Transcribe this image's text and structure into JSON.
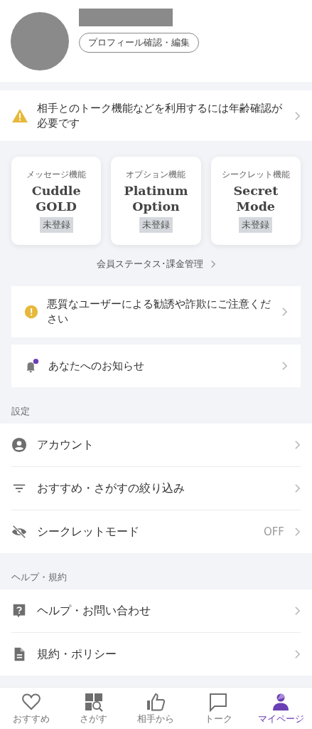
{
  "profile": {
    "edit_button": "プロフィール確認・編集"
  },
  "age_notice": {
    "text": "相手とのトーク機能などを利用するには年齢確認が必要です"
  },
  "plans": [
    {
      "category": "メッセージ機能",
      "name": "Cuddle\nGOLD",
      "status": "未登録"
    },
    {
      "category": "オプション機能",
      "name": "Platinum\nOption",
      "status": "未登録"
    },
    {
      "category": "シークレット機能",
      "name": "Secret\nMode",
      "status": "未登録"
    }
  ],
  "membership_link": "会員ステータス･課金管理",
  "notices": [
    {
      "kind": "caution",
      "text": "悪質なユーザーによる勧誘や詐欺にご注意ください"
    },
    {
      "kind": "notification",
      "text": "あなたへのお知らせ",
      "unread": true
    }
  ],
  "sections": [
    {
      "title": "設定",
      "items": [
        {
          "kind": "account",
          "label": "アカウント"
        },
        {
          "kind": "filter",
          "label": "おすすめ・さがすの絞り込み"
        },
        {
          "kind": "privacy",
          "label": "シークレットモード",
          "value": "OFF"
        }
      ]
    },
    {
      "title": "ヘルプ・規約",
      "items": [
        {
          "kind": "help",
          "label": "ヘルプ・お問い合わせ"
        },
        {
          "kind": "terms",
          "label": "規約・ポリシー"
        }
      ]
    }
  ],
  "nav": [
    {
      "kind": "recommend",
      "label": "おすすめ",
      "selected": false
    },
    {
      "kind": "search",
      "label": "さがす",
      "selected": false
    },
    {
      "kind": "likes",
      "label": "相手から",
      "selected": false
    },
    {
      "kind": "talk",
      "label": "トーク",
      "selected": false
    },
    {
      "kind": "mypage",
      "label": "マイページ",
      "selected": true
    }
  ]
}
